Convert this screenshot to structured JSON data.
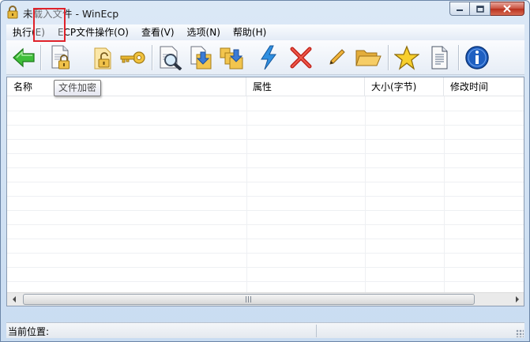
{
  "window": {
    "title": "未载入文件 - WinEcp"
  },
  "menubar": {
    "items": [
      "执行(E)",
      "ECP文件操作(O)",
      "查看(V)",
      "选项(N)",
      "帮助(H)"
    ]
  },
  "toolbar": {
    "buttons": [
      {
        "icon": "back-arrow-icon"
      },
      {
        "icon": "encrypt-file-icon",
        "highlighted": true
      },
      {
        "icon": "decrypt-lock-icon"
      },
      {
        "icon": "key-icon"
      },
      {
        "icon": "view-file-icon"
      },
      {
        "icon": "extract-file-icon"
      },
      {
        "icon": "extract-all-icon"
      },
      {
        "icon": "lightning-icon"
      },
      {
        "icon": "delete-x-icon"
      },
      {
        "icon": "pencil-icon"
      },
      {
        "icon": "folder-open-icon"
      },
      {
        "icon": "star-icon"
      },
      {
        "icon": "document-icon"
      },
      {
        "icon": "info-icon"
      }
    ],
    "highlight_color": "#e0222a"
  },
  "tooltip": {
    "text": "文件加密"
  },
  "list": {
    "columns": [
      "名称",
      "属性",
      "大小(字节)",
      "修改时间"
    ],
    "rows": []
  },
  "status": {
    "location_label": "当前位置:"
  }
}
